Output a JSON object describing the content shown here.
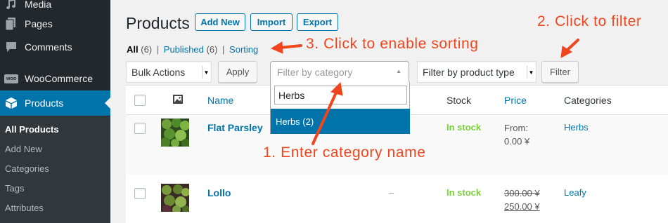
{
  "sidebar": {
    "menu": [
      {
        "label": "Media",
        "icon": "media-icon"
      },
      {
        "label": "Pages",
        "icon": "pages-icon"
      },
      {
        "label": "Comments",
        "icon": "comments-icon"
      },
      {
        "label": "WooCommerce",
        "icon": "woocommerce-icon",
        "badge": "woo"
      },
      {
        "label": "Products",
        "icon": "products-icon"
      }
    ],
    "submenu": [
      "All Products",
      "Add New",
      "Categories",
      "Tags",
      "Attributes"
    ]
  },
  "header": {
    "title": "Products",
    "buttons": [
      "Add New",
      "Import",
      "Export"
    ]
  },
  "views": {
    "all": "All",
    "all_count": "(6)",
    "published": "Published",
    "published_count": "(6)",
    "sorting": "Sorting",
    "sep": "|"
  },
  "filters": {
    "bulk_actions": "Bulk Actions",
    "apply": "Apply",
    "category_placeholder": "Filter by category",
    "product_type": "Filter by product type",
    "filter": "Filter"
  },
  "dropdown": {
    "search_value": "Herbs",
    "option": "Herbs (2)"
  },
  "table": {
    "columns": [
      "Name",
      "Stock",
      "Price",
      "Categories"
    ],
    "rows": [
      {
        "name": "Flat Parsley",
        "sku": "",
        "stock": "In stock",
        "price_line1": "From:",
        "price_line2": "0.00 ¥",
        "category": "Herbs"
      },
      {
        "name": "Lollo",
        "sku": "–",
        "stock": "In stock",
        "price_old": "300.00 ¥",
        "price_new": "250.00 ¥",
        "category": "Leafy"
      }
    ]
  },
  "annotations": {
    "click_to_filter": "2. Click to filter",
    "enable_sorting": "3. Click to enable sorting",
    "enter_category": "1. Enter category name"
  },
  "colors": {
    "annotation": "#f1451d",
    "wp_blue": "#0073aa",
    "sidebar": "#23282d",
    "in_stock": "#7ad03a"
  }
}
